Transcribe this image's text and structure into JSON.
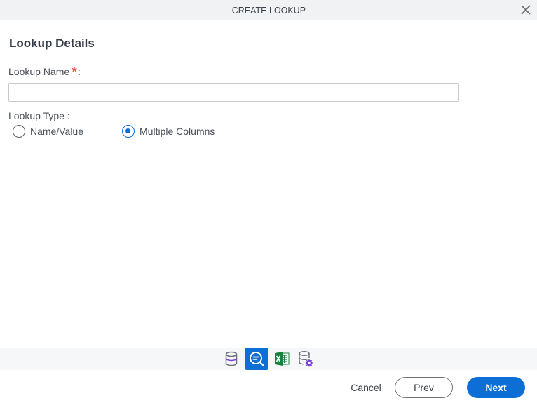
{
  "dialog": {
    "title": "CREATE LOOKUP",
    "close_icon": "close-icon"
  },
  "form": {
    "section_title": "Lookup Details",
    "lookup_name": {
      "label": "Lookup Name",
      "required_marker": "*",
      "colon": ":",
      "value": "",
      "placeholder": ""
    },
    "lookup_type": {
      "label": "Lookup Type :",
      "options": [
        {
          "label": "Name/Value",
          "checked": false
        },
        {
          "label": "Multiple Columns",
          "checked": true
        }
      ],
      "selected": "Multiple Columns"
    }
  },
  "source_icons": [
    {
      "name": "database-icon",
      "active": false
    },
    {
      "name": "search-lookup-icon",
      "active": true
    },
    {
      "name": "excel-icon",
      "active": false
    },
    {
      "name": "database-settings-icon",
      "active": false
    }
  ],
  "footer": {
    "cancel_label": "Cancel",
    "prev_label": "Prev",
    "next_label": "Next"
  },
  "colors": {
    "accent": "#0d6fd6",
    "required": "#e8413c",
    "header_bg": "#f1f2f4",
    "excel_green": "#1e7e3e",
    "icon_purple": "#7a3fd0"
  }
}
